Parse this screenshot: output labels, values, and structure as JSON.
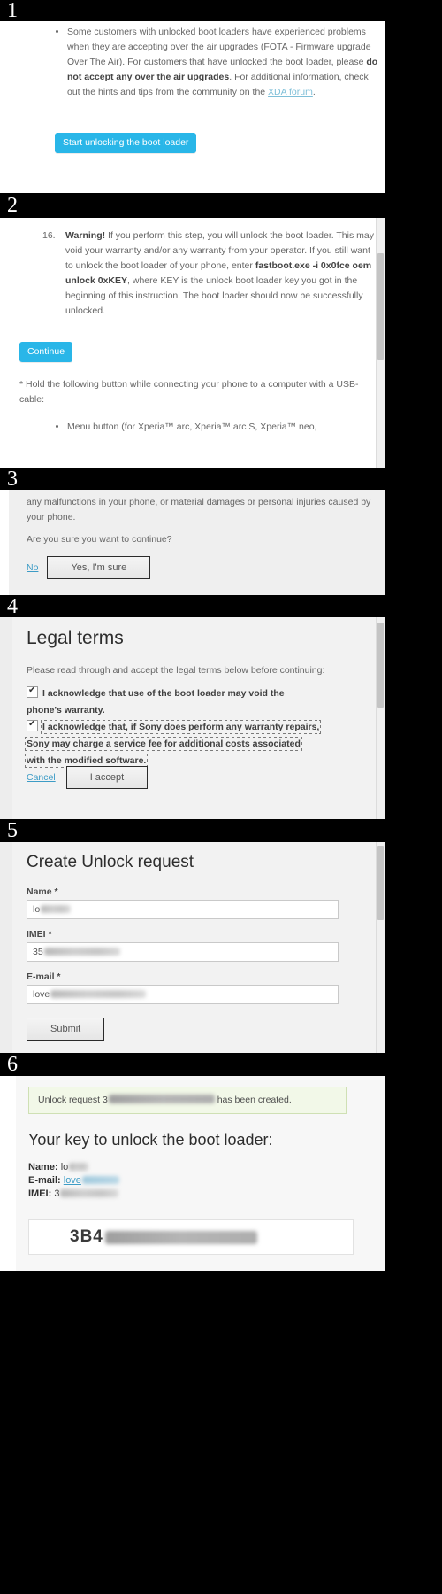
{
  "meta": {
    "background": "#000000",
    "accent_cyan": "#29b6e8",
    "link_blue": "#3d9cc6",
    "notice_green_bg": "#f2f8e8"
  },
  "panels": [
    {
      "number": "1",
      "bullet_text_parts": {
        "p1": "Some customers with unlocked boot loaders have experienced problems when they are accepting over the air upgrades (FOTA - Firmware upgrade Over The Air). For customers that have unlocked the boot loader, please ",
        "bold1": "do not accept any over the air upgrades",
        "p2": ". For additional information, check out the hints and tips from the community on the ",
        "link": "XDA forum",
        "p3": "."
      },
      "button": "Start unlocking the boot loader"
    },
    {
      "number": "2",
      "step_number": "16.",
      "warning_label": "Warning!",
      "warning_body_1": " If you perform this step, you will unlock the boot loader. This may void your warranty and/or any warranty from your operator. If you still want to unlock the boot loader of your phone, enter ",
      "command": "fastboot.exe -i 0x0fce oem unlock 0xKEY",
      "warning_body_2": ", where KEY is the unlock boot loader key you got in the beginning of this instruction. The boot loader should now be successfully unlocked.",
      "button": "Continue",
      "footnote": "* Hold the following button while connecting your phone to a computer with a USB-cable:",
      "footnote_bullet": "Menu button (for Xperia™ arc, Xperia™ arc S, Xperia™ neo,"
    },
    {
      "number": "3",
      "paragraph": "any malfunctions in your phone, or material damages or personal injuries caused by your phone.",
      "question": "Are you sure you want to continue?",
      "cancel_link": "No",
      "confirm_button": "Yes, I'm sure"
    },
    {
      "number": "4",
      "title": "Legal terms",
      "intro": "Please read through and accept the legal terms below before continuing:",
      "checkbox_1": "I acknowledge that use of the boot loader may void the phone's warranty.",
      "checkbox_2": "I acknowledge that, if Sony does perform any warranty repairs, Sony may charge a service fee for additional costs associated with the modified software.",
      "cancel_link": "Cancel",
      "accept_button": "I accept"
    },
    {
      "number": "5",
      "title": "Create Unlock request",
      "fields": [
        {
          "label": "Name *",
          "value": "lo",
          "redacted": true,
          "redact_width": 34
        },
        {
          "label": "IMEI *",
          "value": "35",
          "redacted": true,
          "redact_width": 86
        },
        {
          "label": "E-mail *",
          "value": "love",
          "redacted": true,
          "redact_width": 108
        }
      ],
      "submit_button": "Submit"
    },
    {
      "number": "6",
      "notice_prefix": "Unlock request 3",
      "notice_suffix": " has been created.",
      "title": "Your key to unlock the boot loader:",
      "details": [
        {
          "label": "Name:",
          "value": "lo",
          "redact_width": 22,
          "link": false
        },
        {
          "label": "E-mail:",
          "value": "love",
          "redact_width": 42,
          "link": true
        },
        {
          "label": "IMEI:",
          "value": "3",
          "redact_width": 66,
          "link": false
        }
      ],
      "key_prefix": "3B4",
      "key_redacted": true
    }
  ]
}
